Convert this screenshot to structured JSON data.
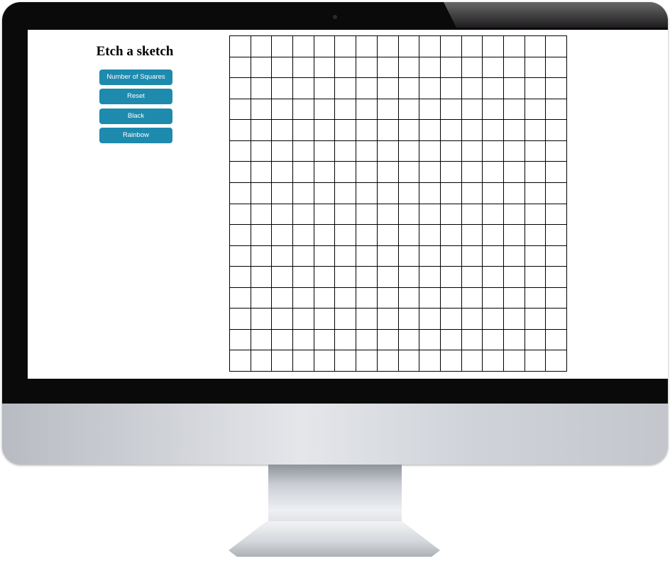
{
  "app": {
    "title": "Etch a sketch"
  },
  "controls": {
    "number_of_squares_label": "Number of Squares",
    "reset_label": "Reset",
    "black_label": "Black",
    "rainbow_label": "Rainbow"
  },
  "grid": {
    "rows": 16,
    "columns": 16,
    "cell_color": "#ffffff",
    "line_color": "#000000"
  },
  "colors": {
    "button": "#1e8aae",
    "button_text": "#ffffff"
  }
}
